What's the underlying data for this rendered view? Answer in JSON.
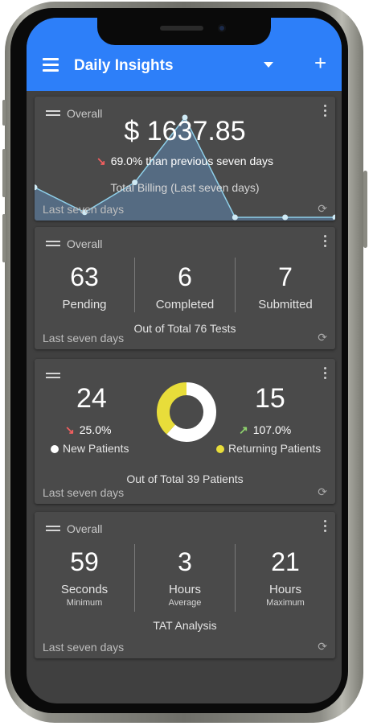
{
  "app": {
    "title": "Daily Insights",
    "accent_color": "#2d7ff9",
    "menu_icon": "hamburger-icon",
    "dropdown_icon": "caret-down-icon",
    "add_label": "+"
  },
  "billing": {
    "label": "Overall",
    "amount": "$ 1637.85",
    "change": "69.0% than previous seven days",
    "change_direction": "down",
    "caption": "Total Billing (Last seven days)",
    "footer": "Last seven days",
    "chart_data": {
      "type": "area",
      "values": [
        6,
        1,
        7,
        20,
        0,
        0,
        0
      ],
      "series_color": "#5f86b0"
    }
  },
  "tests": {
    "label": "Overall",
    "stats": [
      {
        "value": "63",
        "label": "Pending"
      },
      {
        "value": "6",
        "label": "Completed"
      },
      {
        "value": "7",
        "label": "Submitted"
      }
    ],
    "summary": "Out of Total 76 Tests",
    "footer": "Last seven days"
  },
  "patients": {
    "new": {
      "value": "24",
      "pct": "25.0%",
      "label": "New Patients",
      "direction": "down",
      "color": "#ffffff"
    },
    "returning": {
      "value": "15",
      "pct": "107.0%",
      "label": "Returning Patients",
      "direction": "up",
      "color": "#e8dd3a"
    },
    "summary": "Out of Total 39 Patients",
    "footer": "Last seven days",
    "chart_data": {
      "type": "pie",
      "categories": [
        "New Patients",
        "Returning Patients"
      ],
      "values": [
        24,
        15
      ],
      "colors": [
        "#ffffff",
        "#e8dd3a"
      ]
    }
  },
  "tat": {
    "label": "Overall",
    "stats": [
      {
        "value": "59",
        "label": "Seconds",
        "sub": "Minimum"
      },
      {
        "value": "3",
        "label": "Hours",
        "sub": "Average"
      },
      {
        "value": "21",
        "label": "Hours",
        "sub": "Maximum"
      }
    ],
    "summary": "TAT Analysis",
    "footer": "Last seven days"
  }
}
